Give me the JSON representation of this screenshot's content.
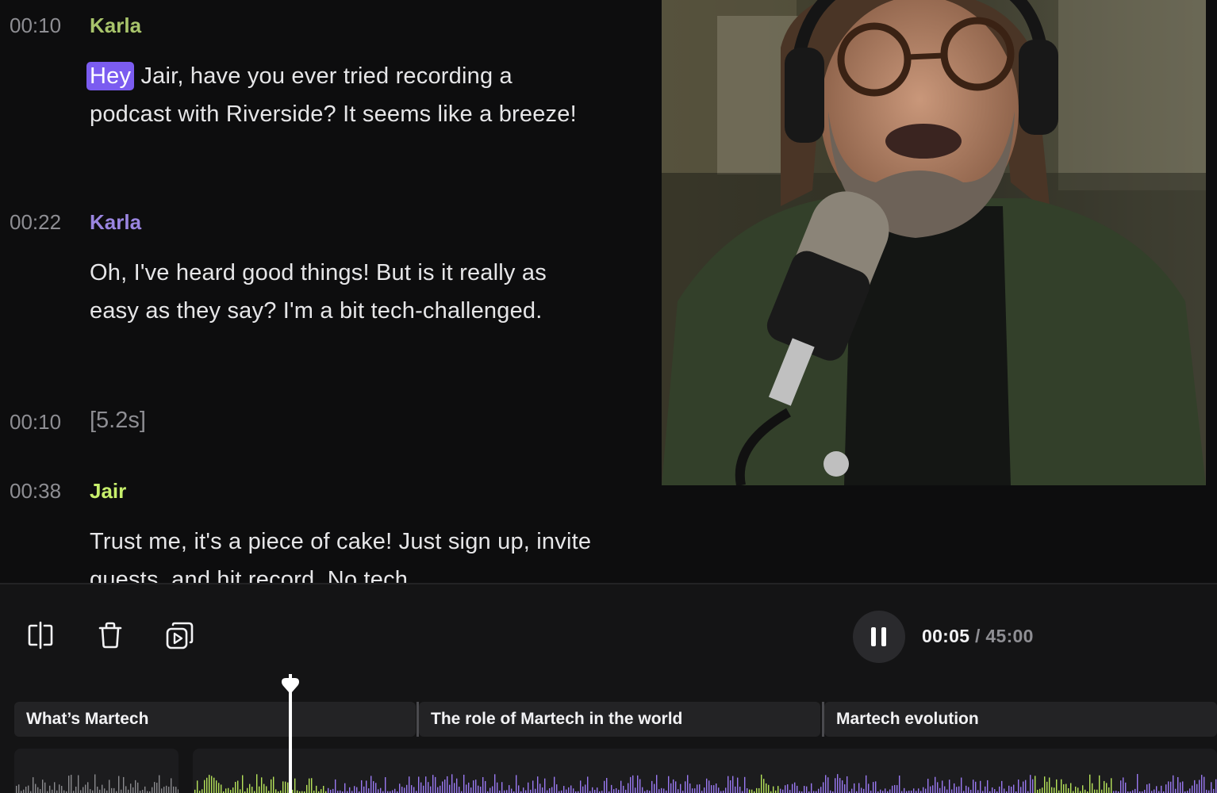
{
  "transcript": [
    {
      "timestamp": "00:10",
      "speaker": "Karla",
      "speaker_color": "#a8c46b",
      "highlight": "Hey",
      "text": "Jair, have you ever tried recording a podcast with Riverside? It seems like a breeze!"
    },
    {
      "timestamp": "00:22",
      "speaker": "Karla",
      "speaker_color": "#9a85e0",
      "text": "Oh, I've heard good things! But is it really as easy as they say? I'm a bit tech-challenged."
    },
    {
      "timestamp": "00:10",
      "pause": "[5.2s]"
    },
    {
      "timestamp": "00:38",
      "speaker": "Jair",
      "speaker_color": "#c7ef6c",
      "text": "Trust me, it's a piece of cake! Just sign up, invite guests, and hit record. No tech"
    }
  ],
  "toolbar": {
    "split_icon": "split-clip-icon",
    "delete_icon": "trash-icon",
    "clips_icon": "video-clips-icon"
  },
  "player": {
    "current_time": "00:05",
    "separator": " / ",
    "total_time": "45:00",
    "state": "playing"
  },
  "chapters": [
    {
      "title": "What’s Martech"
    },
    {
      "title": "The role of Martech in the world"
    },
    {
      "title": "Martech evolution"
    }
  ],
  "colors": {
    "accent": "#7b5cf0",
    "waveform_green": "#b6e35a",
    "waveform_purple": "#9a79f2"
  }
}
